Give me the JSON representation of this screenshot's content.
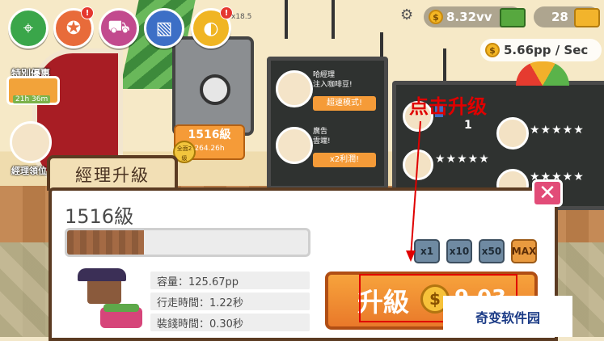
{
  "hud": {
    "icons": [
      {
        "name": "map-icon",
        "color": "#3aa64a",
        "glyph": "⌖"
      },
      {
        "name": "badge-star-icon",
        "color": "#e86b3a",
        "glyph": "✪"
      },
      {
        "name": "shop-cart-icon",
        "color": "#c24a8e",
        "glyph": "⛟"
      },
      {
        "name": "ticket-icon",
        "color": "#3d6fc6",
        "glyph": "▧"
      },
      {
        "name": "coffee-bean-icon",
        "color": "#f0b523",
        "glyph": "◐"
      }
    ],
    "alert_badge": "!",
    "multiplier": "x18.5",
    "settings_glyph": "⚙",
    "coins": "8.32vv",
    "gold": "28",
    "rate": "5.66pp / Sec"
  },
  "events": {
    "special_offer": "特別優惠",
    "timer": "21h 36m",
    "manager_event": "經理領位"
  },
  "scene": {
    "level_tag": "1516級",
    "level_tag_sub": "264.26h",
    "star_badge": "全面2級",
    "board_left": [
      {
        "title": "哈經理",
        "subtitle": "注入咖啡豆!",
        "button": "超速模式!"
      },
      {
        "title": "廣告",
        "subtitle": "雲端!",
        "button": "x2利潤!"
      }
    ],
    "stars": "★★★★★",
    "count_1": "1"
  },
  "panel": {
    "title": "經理升級",
    "level": "1516級",
    "progress_fraction": 0.32,
    "multipliers": [
      "x1",
      "x10",
      "x50",
      "MAX"
    ],
    "stats": [
      "容量：125.67pp",
      "行走時間：1.22秒",
      "裝錢時間：0.30秒"
    ],
    "close_glyph": "✕",
    "upgrade_label": "升級",
    "upgrade_cost": "9.03"
  },
  "annotation": {
    "text": "点击升级"
  },
  "watermark": "奇变软件园",
  "colors": {
    "accent_orange": "#f59b38",
    "close_pink": "#e24c78",
    "annotation_red": "#e00000"
  }
}
